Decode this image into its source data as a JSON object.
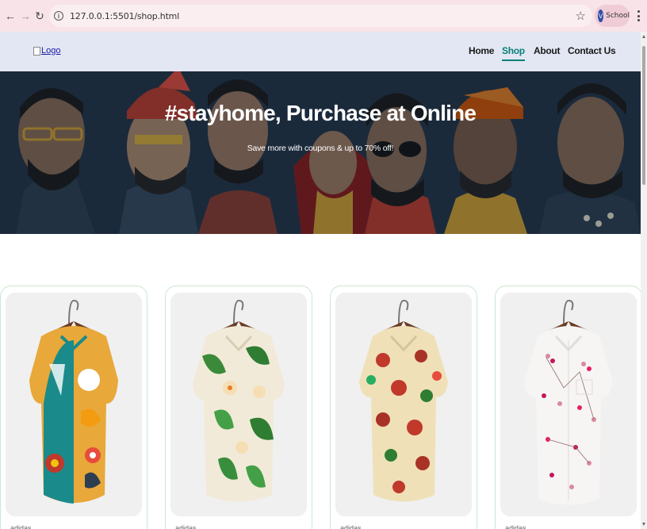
{
  "browser": {
    "url": "127.0.0.1:5501/shop.html",
    "profile_initial": "V",
    "profile_name": "School"
  },
  "header": {
    "logo_alt": "Logo",
    "nav": [
      {
        "label": "Home",
        "active": false
      },
      {
        "label": "Shop",
        "active": true
      },
      {
        "label": "About",
        "active": false
      },
      {
        "label": "Contact Us",
        "active": false
      }
    ]
  },
  "hero": {
    "title": "#stayhome, Purchase at Online",
    "subtitle": "Save more with coupons & up to 70% off!"
  },
  "products": [
    {
      "pattern": "colorful-floral",
      "brand": "adidas"
    },
    {
      "pattern": "green-leaf-tropical",
      "brand": "adidas"
    },
    {
      "pattern": "red-rose-floral",
      "brand": "adidas"
    },
    {
      "pattern": "pink-blossom",
      "brand": "adidas"
    }
  ],
  "colors": {
    "accent": "#088178",
    "header_bg": "#e3e6f3",
    "chrome_bg": "#f7e3e8",
    "card_border": "#cce7d0"
  }
}
